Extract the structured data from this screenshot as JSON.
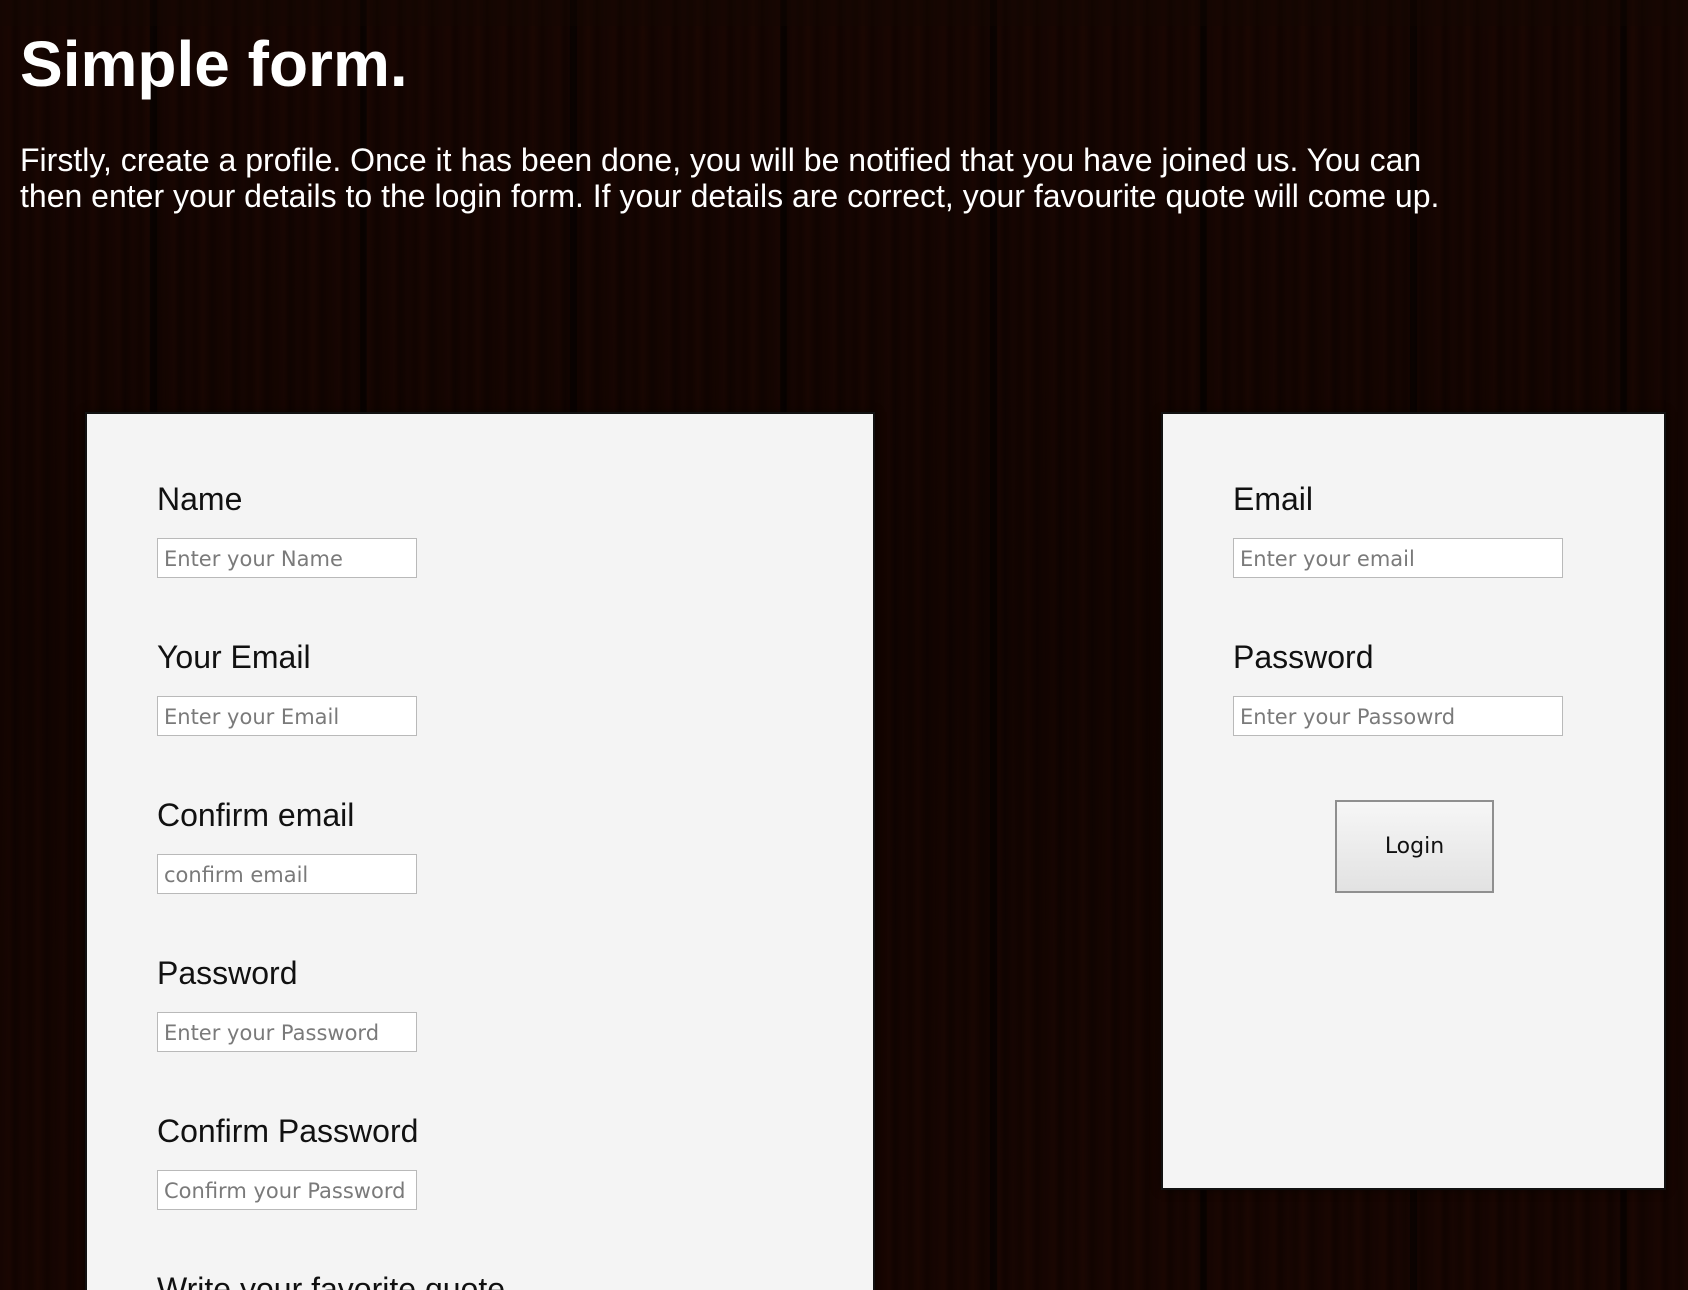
{
  "page": {
    "title": "Simple form.",
    "intro": "Firstly, create a profile. Once it has been done, you will be notified that you have joined us. You can then enter your details to the login form. If your details are correct, your favourite quote will come up."
  },
  "signup_form": {
    "fields": [
      {
        "label": "Name",
        "placeholder": "Enter your Name"
      },
      {
        "label": "Your Email",
        "placeholder": "Enter your Email"
      },
      {
        "label": "Confirm email",
        "placeholder": "confirm email"
      },
      {
        "label": "Password",
        "placeholder": "Enter your Password"
      },
      {
        "label": "Confirm Password",
        "placeholder": "Confirm your Password"
      }
    ],
    "quote_label": "Write your favorite quote"
  },
  "login_form": {
    "email_label": "Email",
    "email_placeholder": "Enter your email",
    "password_label": "Password",
    "password_placeholder": "Enter your Passowrd",
    "button_label": "Login"
  },
  "colors": {
    "panel_background": "#f4f4f4",
    "text_on_wood": "#ffffff",
    "wood": "#4a2414"
  }
}
